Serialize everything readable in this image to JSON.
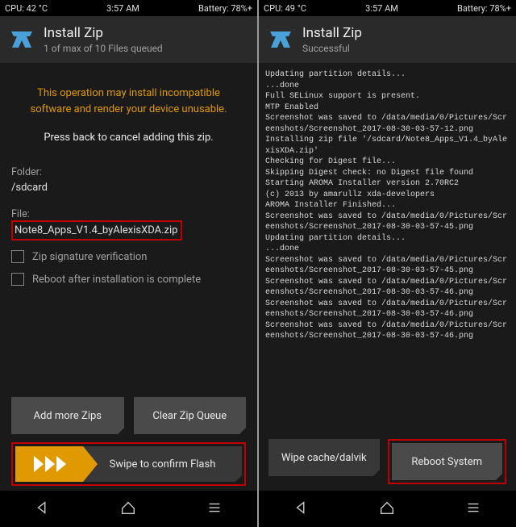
{
  "left": {
    "status": {
      "cpu": "CPU: 42 °C",
      "time": "3:57 AM",
      "battery": "Battery: 78%+"
    },
    "header": {
      "title": "Install Zip",
      "sub": "1 of max of 10 Files queued"
    },
    "warn_line1": "This operation may install incompatible",
    "warn_line2": "software and render your device unusable.",
    "info": "Press back to cancel adding this zip.",
    "folder_label": "Folder:",
    "folder_value": "/sdcard",
    "file_label": "File:",
    "file_value": "Note8_Apps_V1.4_byAlexisXDA.zip",
    "check1": "Zip signature verification",
    "check2": "Reboot after installation is complete",
    "btn_add": "Add more Zips",
    "btn_clear": "Clear Zip Queue",
    "swipe_label": "Swipe to confirm Flash"
  },
  "right": {
    "status": {
      "cpu": "CPU: 49 °C",
      "time": "3:57 AM",
      "battery": "Battery: 78%+"
    },
    "header": {
      "title": "Install Zip",
      "sub": "Successful"
    },
    "log": "Updating partition details...\n...done\nFull SELinux support is present.\nMTP Enabled\nScreenshot was saved to /data/media/0/Pictures/Screenshots/Screenshot_2017-08-30-03-57-12.png\nInstalling zip file '/sdcard/Note8_Apps_V1.4_byAlexisXDA.zip'\nChecking for Digest file...\nSkipping Digest check: no Digest file found\nStarting AROMA Installer version 2.70RC2\n(c) 2013 by amarullz xda-developers\nAROMA Installer Finished...\nScreenshot was saved to /data/media/0/Pictures/Screenshots/Screenshot_2017-08-30-03-57-45.png\nUpdating partition details...\n...done\nScreenshot was saved to /data/media/0/Pictures/Screenshots/Screenshot_2017-08-30-03-57-45.png\nScreenshot was saved to /data/media/0/Pictures/Screenshots/Screenshot_2017-08-30-03-57-46.png\nScreenshot was saved to /data/media/0/Pictures/Screenshots/Screenshot_2017-08-30-03-57-46.png\nScreenshot was saved to /data/media/0/Pictures/Screenshots/Screenshot_2017-08-30-03-57-46.png",
    "btn_wipe": "Wipe cache/dalvik",
    "btn_reboot": "Reboot System"
  }
}
